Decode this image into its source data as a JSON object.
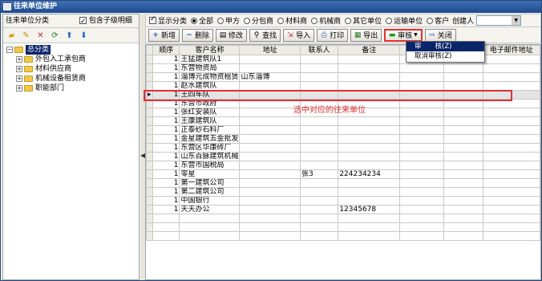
{
  "window": {
    "title": "往来单位维护"
  },
  "left": {
    "header_label": "往来单位分类",
    "include_children_label": "包含子级明细",
    "include_children_checked": true,
    "tools": [
      "open-folder-icon",
      "edit-icon",
      "delete-icon",
      "refresh-icon",
      "up-arrow-icon",
      "down-arrow-icon"
    ],
    "tree": {
      "root": "总分类",
      "children": [
        "外包入工承包商",
        "材料供应商",
        "机械设备租赁商",
        "职能部门"
      ]
    }
  },
  "filter": {
    "show_category_label": "显示分类",
    "show_category_checked": true,
    "options": [
      "全部",
      "甲方",
      "分包商",
      "材料商",
      "机械商",
      "其它单位",
      "运输单位",
      "客户"
    ],
    "selected": "全部",
    "creator_label": "创建人",
    "creator_value": ""
  },
  "toolbar": {
    "add": "新增",
    "delete": "删除",
    "modify": "修改",
    "query": "查找",
    "import": "导入",
    "print": "打印",
    "export": "导出",
    "audit": "审核",
    "close": "关闭"
  },
  "audit_menu": {
    "items": [
      "审　　核(Z)",
      "取消审核(Z)"
    ]
  },
  "grid": {
    "columns": [
      "顺序",
      "客户名称",
      "地址",
      "联系人",
      "备注",
      "",
      "",
      "电子邮件地址"
    ],
    "rows": [
      {
        "order": "1",
        "name": "王猛建筑队1",
        "addr": "",
        "contact": "",
        "note": ""
      },
      {
        "order": "1",
        "name": "东营物资局",
        "addr": "",
        "contact": "",
        "note": ""
      },
      {
        "order": "1",
        "name": "淄博元成物资租赁",
        "addr": "山东淄博",
        "contact": "",
        "note": ""
      },
      {
        "order": "1",
        "name": "赵水建筑队",
        "addr": "",
        "contact": "",
        "note": ""
      },
      {
        "order": "1",
        "name": "王四车队",
        "addr": "",
        "contact": "",
        "note": ""
      },
      {
        "order": "1",
        "name": "东营市政府",
        "addr": "",
        "contact": "",
        "note": ""
      },
      {
        "order": "1",
        "name": "张红安装队",
        "addr": "",
        "contact": "",
        "note": ""
      },
      {
        "order": "1",
        "name": "王康建筑队",
        "addr": "",
        "contact": "",
        "note": ""
      },
      {
        "order": "1",
        "name": "正泰砂石料厂",
        "addr": "",
        "contact": "",
        "note": ""
      },
      {
        "order": "1",
        "name": "金星建筑五金批发",
        "addr": "",
        "contact": "",
        "note": ""
      },
      {
        "order": "1",
        "name": "东营区华康砖厂",
        "addr": "",
        "contact": "",
        "note": ""
      },
      {
        "order": "1",
        "name": "山东百脉建筑机械",
        "addr": "",
        "contact": "",
        "note": ""
      },
      {
        "order": "1",
        "name": "东营市国税局",
        "addr": "",
        "contact": "",
        "note": ""
      },
      {
        "order": "1",
        "name": "零星",
        "addr": "",
        "contact": "张3",
        "note": "224234234"
      },
      {
        "order": "1",
        "name": "第一建筑公司",
        "addr": "",
        "contact": "",
        "note": ""
      },
      {
        "order": "1",
        "name": "第二建筑公司",
        "addr": "",
        "contact": "",
        "note": ""
      },
      {
        "order": "1",
        "name": "中国银行",
        "addr": "",
        "contact": "",
        "note": ""
      },
      {
        "order": "1",
        "name": "天天办公",
        "addr": "",
        "contact": "",
        "note": "12345678"
      }
    ],
    "selected_index": 4
  },
  "annotation": {
    "text": "选中对应的往来单位"
  }
}
